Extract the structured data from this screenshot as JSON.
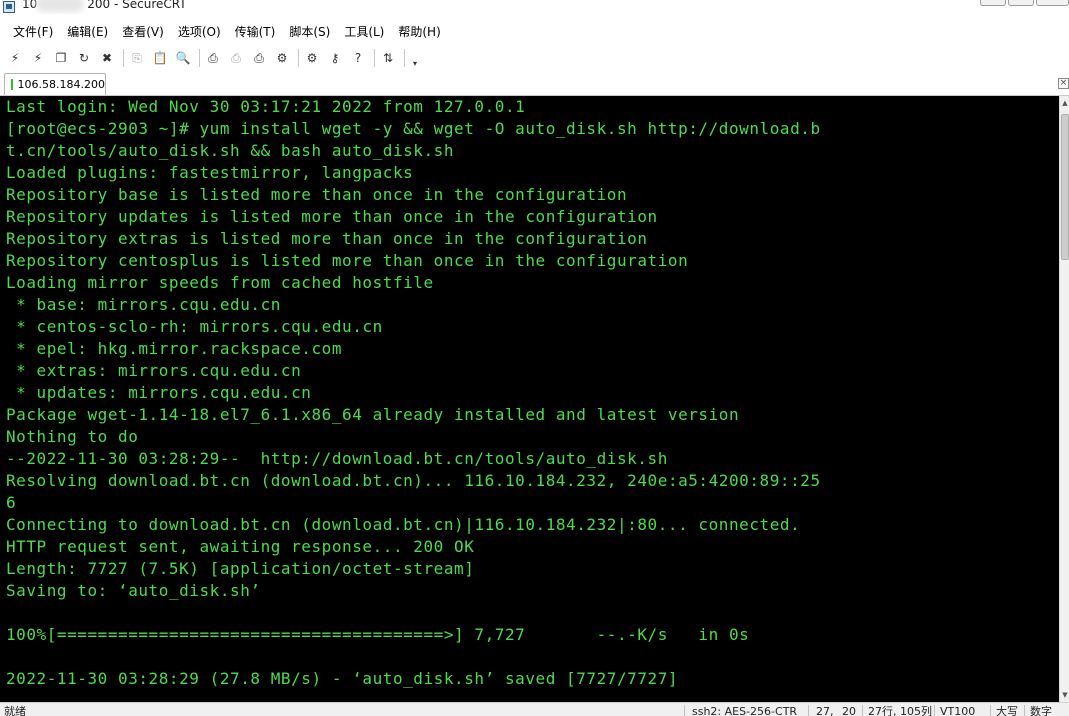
{
  "window": {
    "title_prefix": "10",
    "title_suffix": "200 - SecureCRT"
  },
  "menu": [
    {
      "label": "文件(F)"
    },
    {
      "label": "编辑(E)"
    },
    {
      "label": "查看(V)"
    },
    {
      "label": "选项(O)"
    },
    {
      "label": "传输(T)"
    },
    {
      "label": "脚本(S)"
    },
    {
      "label": "工具(L)"
    },
    {
      "label": "帮助(H)"
    }
  ],
  "toolbar": {
    "buttons": [
      {
        "name": "connect-icon",
        "glyph": "⚡"
      },
      {
        "name": "quick-connect-icon",
        "glyph": "⚡"
      },
      {
        "name": "connect-tab-icon",
        "glyph": "❐"
      },
      {
        "name": "reconnect-icon",
        "glyph": "↻"
      },
      {
        "name": "disconnect-icon",
        "glyph": "✖"
      },
      {
        "name": "copy-icon",
        "glyph": "⎘",
        "dim": true
      },
      {
        "name": "paste-icon",
        "glyph": "📋"
      },
      {
        "name": "find-icon",
        "glyph": "🔍"
      },
      {
        "name": "print-icon",
        "glyph": "⎙"
      },
      {
        "name": "print-preview-icon",
        "glyph": "⎙",
        "dim": true
      },
      {
        "name": "print-setup-icon",
        "glyph": "⎙"
      },
      {
        "name": "session-options-icon",
        "glyph": "⚙"
      },
      {
        "name": "global-options-icon",
        "glyph": "⚙"
      },
      {
        "name": "keymap-icon",
        "glyph": "⚷"
      },
      {
        "name": "help-icon",
        "glyph": "?"
      },
      {
        "name": "sftp-icon",
        "glyph": "⇅"
      }
    ]
  },
  "tabs": [
    {
      "label": "106.58.184.200",
      "status_color": "#2fbf2f"
    }
  ],
  "terminal": {
    "text_color": "#4ddb4d",
    "background": "#000000",
    "lines": [
      "Last login: Wed Nov 30 03:17:21 2022 from 127.0.0.1",
      "[root@ecs-2903 ~]# yum install wget -y && wget -O auto_disk.sh http://download.b",
      "t.cn/tools/auto_disk.sh && bash auto_disk.sh",
      "Loaded plugins: fastestmirror, langpacks",
      "Repository base is listed more than once in the configuration",
      "Repository updates is listed more than once in the configuration",
      "Repository extras is listed more than once in the configuration",
      "Repository centosplus is listed more than once in the configuration",
      "Loading mirror speeds from cached hostfile",
      " * base: mirrors.cqu.edu.cn",
      " * centos-sclo-rh: mirrors.cqu.edu.cn",
      " * epel: hkg.mirror.rackspace.com",
      " * extras: mirrors.cqu.edu.cn",
      " * updates: mirrors.cqu.edu.cn",
      "Package wget-1.14-18.el7_6.1.x86_64 already installed and latest version",
      "Nothing to do",
      "--2022-11-30 03:28:29--  http://download.bt.cn/tools/auto_disk.sh",
      "Resolving download.bt.cn (download.bt.cn)... 116.10.184.232, 240e:a5:4200:89::25",
      "6",
      "Connecting to download.bt.cn (download.bt.cn)|116.10.184.232|:80... connected.",
      "HTTP request sent, awaiting response... 200 OK",
      "Length: 7727 (7.5K) [application/octet-stream]",
      "Saving to: ‘auto_disk.sh’",
      "",
      "100%[======================================>] 7,727       --.-K/s   in 0s",
      "",
      "2022-11-30 03:28:29 (27.8 MB/s) - ‘auto_disk.sh’ saved [7727/7727]"
    ]
  },
  "status": {
    "ready": "就绪",
    "cipher": "ssh2: AES-256-CTR",
    "cursor_row": "27,",
    "cursor_col": "20",
    "size": "27行, 105列",
    "emulation": "VT100",
    "caps": "大写",
    "num": "数字"
  }
}
